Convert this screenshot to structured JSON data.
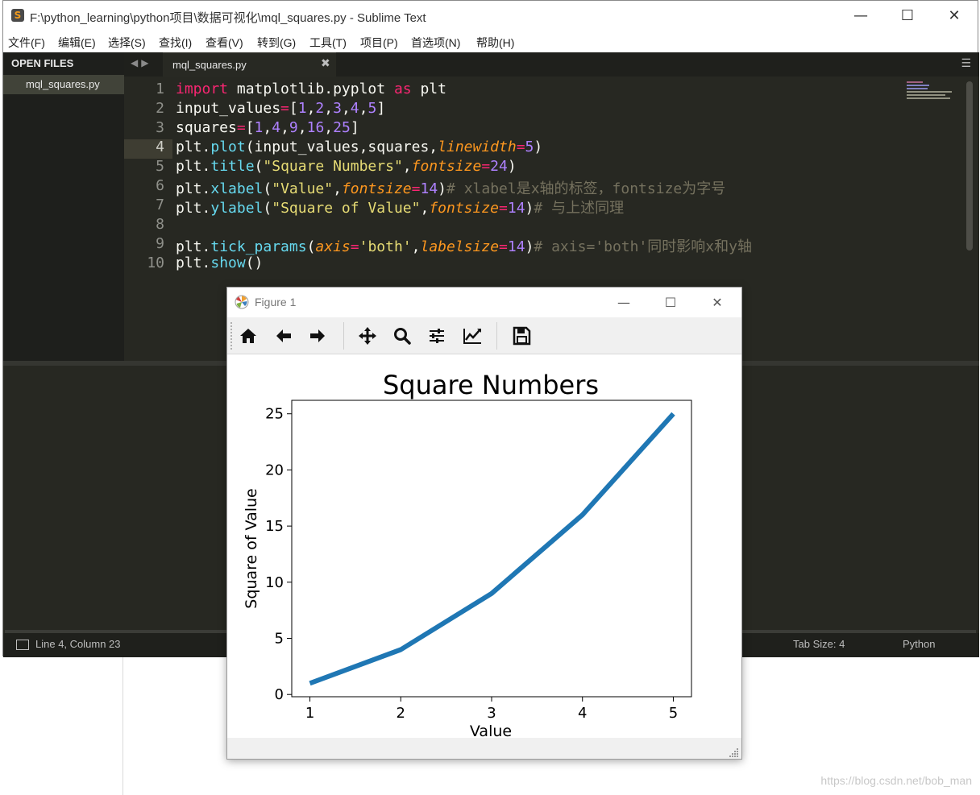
{
  "background": {
    "watermark": "https://blog.csdn.net/bob_man"
  },
  "sublime": {
    "title": "F:\\python_learning\\python项目\\数据可视化\\mql_squares.py - Sublime Text",
    "menu": [
      "文件(F)",
      "编辑(E)",
      "选择(S)",
      "查找(I)",
      "查看(V)",
      "转到(G)",
      "工具(T)",
      "项目(P)",
      "首选项(N)",
      "帮助(H)"
    ],
    "sidebar": {
      "heading": "OPEN FILES",
      "file": "mql_squares.py"
    },
    "tab": {
      "label": "mql_squares.py"
    },
    "line_numbers": [
      "1",
      "2",
      "3",
      "4",
      "5",
      "6",
      "7",
      "8",
      "9",
      "10"
    ],
    "status": {
      "position": "Line 4, Column 23",
      "tab_size": "Tab Size: 4",
      "syntax": "Python"
    },
    "colors": {
      "editor_bg": "#272822",
      "keyword": "#f92672",
      "function": "#66d9ef",
      "number": "#ae81ff",
      "string": "#e6db74",
      "argument": "#fd971f",
      "comment": "#75715e"
    }
  },
  "code": {
    "l1": [
      "import",
      " matplotlib.pyplot ",
      "as",
      " plt"
    ],
    "l2": [
      "input_values",
      "=",
      "[",
      "1",
      ",",
      "2",
      ",",
      "3",
      ",",
      "4",
      ",",
      "5",
      "]"
    ],
    "l3": [
      "squares",
      "=",
      "[",
      "1",
      ",",
      "4",
      ",",
      "9",
      ",",
      "16",
      ",",
      "25",
      "]"
    ],
    "l4": [
      "plt.",
      "plot",
      "(input_values,squares,",
      "linewidth",
      "=",
      "5",
      ")"
    ],
    "l5": [
      "plt.",
      "title",
      "(",
      "\"Square Numbers\"",
      ",",
      "fontsize",
      "=",
      "24",
      ")"
    ],
    "l6": [
      "plt.",
      "xlabel",
      "(",
      "\"Value\"",
      ",",
      "fontsize",
      "=",
      "14",
      ")",
      "# xlabel是x轴的标签，fontsize为字号"
    ],
    "l7": [
      "plt.",
      "ylabel",
      "(",
      "\"Square of Value\"",
      ",",
      "fontsize",
      "=",
      "14",
      ")",
      "# 与上述同理"
    ],
    "l9": [
      "plt.",
      "tick_params",
      "(",
      "axis",
      "=",
      "'both'",
      ",",
      "labelsize",
      "=",
      "14",
      ")",
      "# axis='both'同时影响x和y轴"
    ],
    "l10": [
      "plt.",
      "show",
      "()"
    ]
  },
  "figure": {
    "title": "Figure 1",
    "toolbar": [
      "home-icon",
      "back-arrow-icon",
      "forward-arrow-icon",
      "pan-icon",
      "zoom-icon",
      "configure-subplots-icon",
      "edit-axis-icon",
      "save-icon"
    ]
  },
  "chart_data": {
    "type": "line",
    "title": "Square Numbers",
    "xlabel": "Value",
    "ylabel": "Square of Value",
    "x": [
      1,
      2,
      3,
      4,
      5
    ],
    "series": [
      {
        "values": [
          1,
          4,
          9,
          16,
          25
        ],
        "color": "#1f77b4"
      }
    ],
    "xticks": [
      "1",
      "2",
      "3",
      "4",
      "5"
    ],
    "yticks": [
      "0",
      "5",
      "10",
      "15",
      "20",
      "25"
    ],
    "xlim": [
      0.8,
      5.2
    ],
    "ylim": [
      -0.2,
      26.2
    ],
    "grid": false
  }
}
